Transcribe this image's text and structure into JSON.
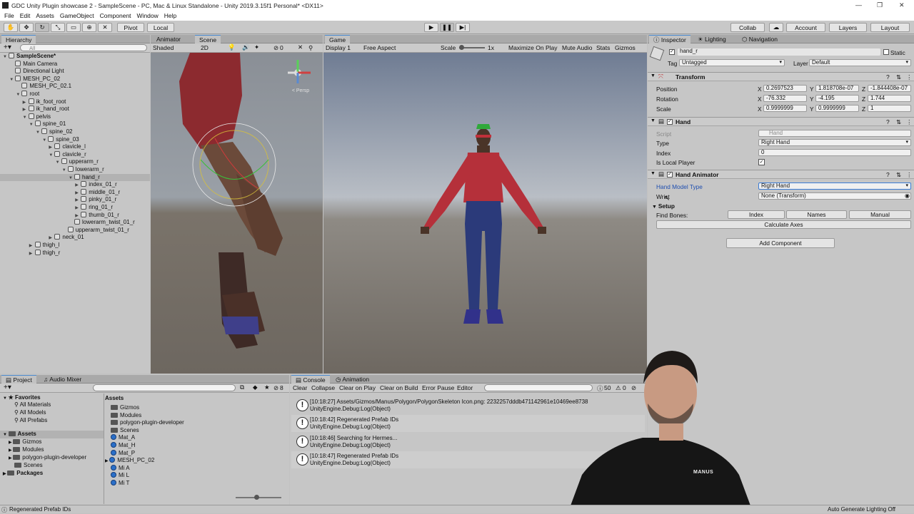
{
  "window": {
    "title": "GDC Unity Plugin showcase 2 - SampleScene - PC, Mac & Linux Standalone - Unity 2019.3.15f1 Personal* <DX11>",
    "minimize": "—",
    "maximize": "❐",
    "close": "✕"
  },
  "menu": [
    "File",
    "Edit",
    "Assets",
    "GameObject",
    "Component",
    "Window",
    "Help"
  ],
  "toolbar": {
    "pivot": "Pivot",
    "local": "Local",
    "collab": "Collab",
    "account": "Account",
    "layers": "Layers",
    "layout": "Layout"
  },
  "hierarchy": {
    "tab": "Hierarchy",
    "search": "All",
    "items": [
      {
        "label": "SampleScene*",
        "indent": 0,
        "expanded": true,
        "bold": true
      },
      {
        "label": "Main Camera",
        "indent": 1
      },
      {
        "label": "Directional Light",
        "indent": 1
      },
      {
        "label": "MESH_PC_02",
        "indent": 1,
        "expanded": true
      },
      {
        "label": "MESH_PC_02.1",
        "indent": 2
      },
      {
        "label": "root",
        "indent": 2,
        "expanded": true
      },
      {
        "label": "ik_foot_root",
        "indent": 3,
        "collapsed": true
      },
      {
        "label": "ik_hand_root",
        "indent": 3,
        "collapsed": true
      },
      {
        "label": "pelvis",
        "indent": 3,
        "expanded": true
      },
      {
        "label": "spine_01",
        "indent": 4,
        "expanded": true
      },
      {
        "label": "spine_02",
        "indent": 5,
        "expanded": true
      },
      {
        "label": "spine_03",
        "indent": 6,
        "expanded": true
      },
      {
        "label": "clavicle_l",
        "indent": 7,
        "collapsed": true
      },
      {
        "label": "clavicle_r",
        "indent": 7,
        "expanded": true
      },
      {
        "label": "upperarm_r",
        "indent": 8,
        "expanded": true
      },
      {
        "label": "lowerarm_r",
        "indent": 9,
        "expanded": true
      },
      {
        "label": "hand_r",
        "indent": 10,
        "expanded": true,
        "selected": true
      },
      {
        "label": "index_01_r",
        "indent": 11,
        "collapsed": true
      },
      {
        "label": "middle_01_r",
        "indent": 11,
        "collapsed": true
      },
      {
        "label": "pinky_01_r",
        "indent": 11,
        "collapsed": true
      },
      {
        "label": "ring_01_r",
        "indent": 11,
        "collapsed": true
      },
      {
        "label": "thumb_01_r",
        "indent": 11,
        "collapsed": true
      },
      {
        "label": "lowerarm_twist_01_r",
        "indent": 10
      },
      {
        "label": "upperarm_twist_01_r",
        "indent": 9
      },
      {
        "label": "neck_01",
        "indent": 7,
        "collapsed": true
      },
      {
        "label": "thigh_l",
        "indent": 4,
        "collapsed": true
      },
      {
        "label": "thigh_r",
        "indent": 4,
        "collapsed": true
      }
    ]
  },
  "scene": {
    "tab_animator": "Animator",
    "tab_scene": "Scene",
    "shading": "Shaded",
    "mode": "2D",
    "count": "0",
    "persp": "< Persp"
  },
  "game": {
    "tab": "Game",
    "display": "Display 1",
    "aspect": "Free Aspect",
    "scale_label": "Scale",
    "scale_value": "1x",
    "maximize": "Maximize On Play",
    "mute": "Mute Audio",
    "stats": "Stats",
    "gizmos": "Gizmos"
  },
  "inspector": {
    "tabs": [
      "Inspector",
      "Lighting",
      "Navigation"
    ],
    "object_name": "hand_r",
    "static": "Static",
    "tag_label": "Tag",
    "tag_value": "Untagged",
    "layer_label": "Layer",
    "layer_value": "Default",
    "transform": {
      "title": "Transform",
      "position": {
        "label": "Position",
        "x": "0.2697523",
        "y": "1.818708e-07",
        "z": "-1.844408e-07"
      },
      "rotation": {
        "label": "Rotation",
        "x": "-76.332",
        "y": "-4.195",
        "z": "1.744"
      },
      "scale": {
        "label": "Scale",
        "x": "0.9999999",
        "y": "0.9999999",
        "z": "1"
      }
    },
    "hand": {
      "title": "Hand",
      "script_label": "Script",
      "script_value": "Hand",
      "type_label": "Type",
      "type_value": "Right Hand",
      "index_label": "Index",
      "index_value": "0",
      "local_label": "Is Local Player"
    },
    "hand_animator": {
      "title": "Hand Animator",
      "model_type_label": "Hand Model Type",
      "model_type_value": "Right Hand",
      "wrist_label": "Wrist",
      "wrist_value": "None (Transform)",
      "setup_label": "Setup",
      "find_bones_label": "Find Bones:",
      "btn_index": "Index",
      "btn_names": "Names",
      "btn_manual": "Manual",
      "btn_calc": "Calculate Axes"
    },
    "add_component": "Add Component"
  },
  "project": {
    "tabs": [
      "Project",
      "Audio Mixer"
    ],
    "count": "8",
    "favorites": {
      "title": "Favorites",
      "items": [
        "All Materials",
        "All Models",
        "All Prefabs"
      ]
    },
    "assets_tree": {
      "title": "Assets",
      "items": [
        "Gizmos",
        "Modules",
        "polygon-plugin-developer",
        "Scenes"
      ]
    },
    "packages": "Packages",
    "assets_header": "Assets",
    "assets": [
      {
        "label": "Gizmos",
        "kind": "folder"
      },
      {
        "label": "Modules",
        "kind": "folder"
      },
      {
        "label": "polygon-plugin-developer",
        "kind": "folder"
      },
      {
        "label": "Scenes",
        "kind": "folder"
      },
      {
        "label": "Mat_A",
        "kind": "mat"
      },
      {
        "label": "Mat_H",
        "kind": "mat"
      },
      {
        "label": "Mat_P",
        "kind": "mat"
      },
      {
        "label": "MESH_PC_02",
        "kind": "mesh"
      },
      {
        "label": "Mi A",
        "kind": "mat"
      },
      {
        "label": "Mi L",
        "kind": "mat"
      },
      {
        "label": "Mi T",
        "kind": "mat"
      }
    ]
  },
  "console": {
    "tabs": [
      "Console",
      "Animation"
    ],
    "buttons": [
      "Clear",
      "Collapse",
      "Clear on Play",
      "Clear on Build",
      "Error Pause",
      "Editor"
    ],
    "count_log": "50",
    "count_warn": "0",
    "entries": [
      {
        "line1": "[10:18:27] Assets/Gizmos/Manus/Polygon/PolygonSkeleton Icon.png: 2232257dddb471142961e10469ee8738",
        "line2": "UnityEngine.Debug:Log(Object)"
      },
      {
        "line1": "[10:18:42] Regenerated Prefab IDs",
        "line2": "UnityEngine.Debug:Log(Object)"
      },
      {
        "line1": "[10:18:46] Searching for Hermes...",
        "line2": "UnityEngine.Debug:Log(Object)"
      },
      {
        "line1": "[10:18:47] Regenerated Prefab IDs",
        "line2": "UnityEngine.Debug:Log(Object)"
      }
    ]
  },
  "statusbar": {
    "left": "Regenerated Prefab IDs",
    "right": "Auto Generate Lighting Off"
  },
  "presenter": {
    "shirt_text": "MANUS"
  }
}
